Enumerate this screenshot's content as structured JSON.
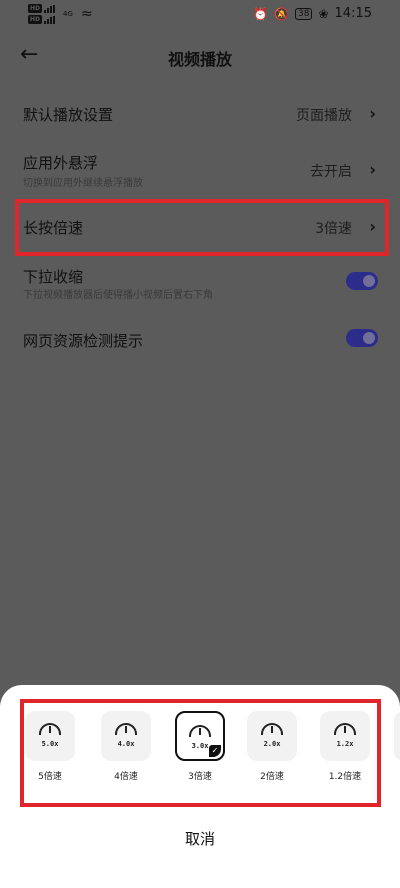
{
  "status_bar": {
    "sim1": "HD",
    "sim2": "HD",
    "network": "4G",
    "battery": "38",
    "time": "14:15"
  },
  "header": {
    "title": "视频播放"
  },
  "settings": [
    {
      "title": "默认播放设置",
      "value": "页面播放"
    },
    {
      "title": "应用外悬浮",
      "subtitle": "切换到应用外继续悬浮播放",
      "value": "去开启"
    },
    {
      "title": "长按倍速",
      "value": "3倍速"
    },
    {
      "title": "下拉收缩",
      "subtitle": "下拉视频播放器后使得播小视频后置右下角",
      "toggle": true
    },
    {
      "title": "网页资源检测提示",
      "toggle": true
    }
  ],
  "sheet": {
    "speeds": [
      {
        "badge": "5.0x",
        "label": "5倍速",
        "selected": false
      },
      {
        "badge": "4.0x",
        "label": "4倍速",
        "selected": false
      },
      {
        "badge": "3.0x",
        "label": "3倍速",
        "selected": true
      },
      {
        "badge": "2.0x",
        "label": "2倍速",
        "selected": false
      },
      {
        "badge": "1.2x",
        "label": "1.2倍速",
        "selected": false
      }
    ],
    "cancel_label": "取消"
  },
  "colors": {
    "highlight": "#e0262b",
    "toggle_on": "#2c2c8a",
    "overlay": "#5b5b5b"
  }
}
